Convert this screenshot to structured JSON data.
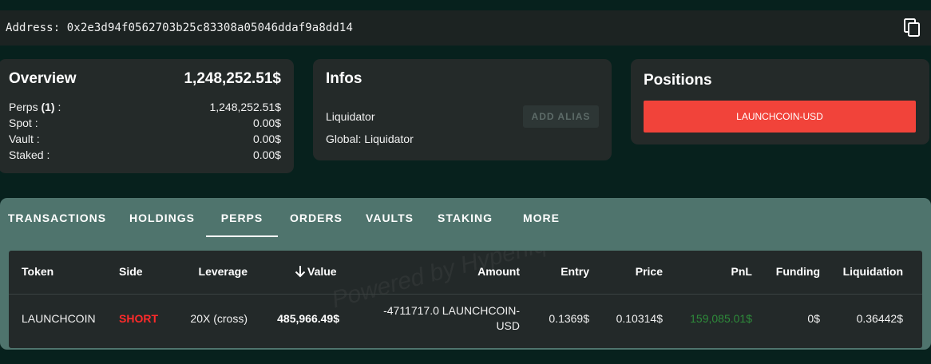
{
  "address": {
    "label": "Address:",
    "value": "0x2e3d94f0562703b25c83308a05046ddaf9a8dd14"
  },
  "overview": {
    "title": "Overview",
    "total": "1,248,252.51$",
    "perps_label": "Perps",
    "perps_count": "(1)",
    "perps_value": "1,248,252.51$",
    "spot_label": "Spot :",
    "spot_value": "0.00$",
    "vault_label": "Vault :",
    "vault_value": "0.00$",
    "staked_label": "Staked :",
    "staked_value": "0.00$"
  },
  "infos": {
    "title": "Infos",
    "label": "Liquidator",
    "add_alias": "ADD ALIAS",
    "global": "Global: Liquidator"
  },
  "positions": {
    "title": "Positions",
    "items": [
      "LAUNCHCOIN-USD"
    ]
  },
  "tabs": [
    "TRANSACTIONS",
    "HOLDINGS",
    "PERPS",
    "ORDERS",
    "VAULTS",
    "STAKING",
    "MORE"
  ],
  "active_tab": "PERPS",
  "table": {
    "headers": [
      "Token",
      "Side",
      "Leverage",
      "Value",
      "Amount",
      "Entry",
      "Price",
      "PnL",
      "Funding",
      "Liquidation"
    ],
    "rows": [
      {
        "token": "LAUNCHCOIN",
        "side": "SHORT",
        "leverage": "20X (cross)",
        "value": "485,966.49$",
        "amount_line1": "-4711717.0 LAUNCHCOIN-",
        "amount_line2": "USD",
        "entry": "0.1369$",
        "price": "0.10314$",
        "pnl": "159,085.01$",
        "funding": "0$",
        "liquidation": "0.36442$"
      }
    ]
  },
  "watermark": "Powered by Hyperliquid",
  "colors": {
    "background": "#07211d",
    "card": "#242a29",
    "tab_bar": "#4f746d",
    "position_button": "#f1433a",
    "short": "#ff2a2a",
    "pnl_positive": "#2e8b3a"
  }
}
